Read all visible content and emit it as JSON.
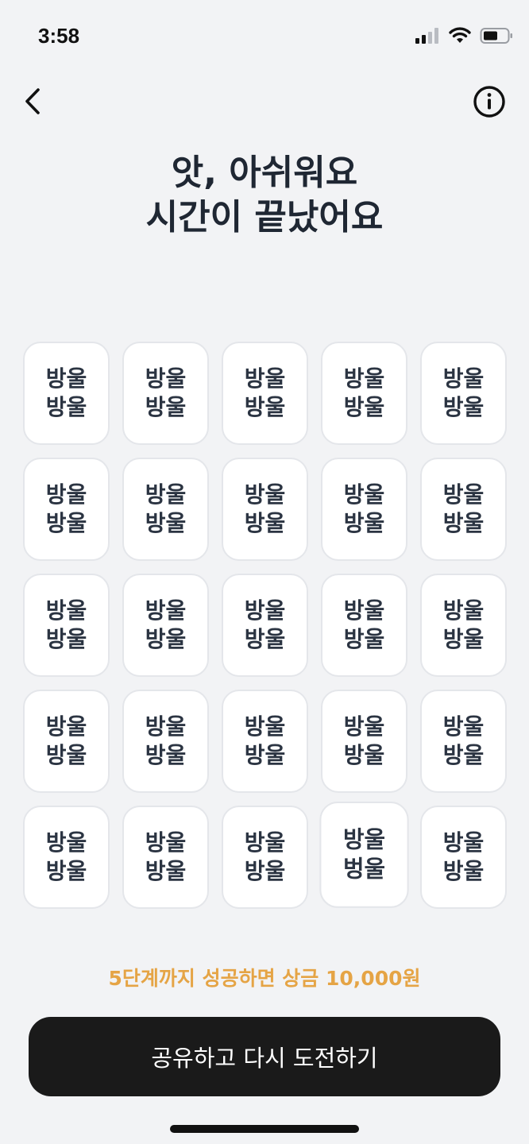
{
  "status_bar": {
    "time": "3:58",
    "icons": [
      "cellular-signal-icon",
      "wifi-icon",
      "battery-icon"
    ]
  },
  "nav": {
    "back_icon": "chevron-left-icon",
    "info_icon": "info-circle-icon"
  },
  "title": {
    "line1": "앗, 아쉬워요",
    "line2": "시간이 끝났어요"
  },
  "grid": {
    "tiles": [
      {
        "top": "방울",
        "bottom": "방울"
      },
      {
        "top": "방울",
        "bottom": "방울"
      },
      {
        "top": "방울",
        "bottom": "방울"
      },
      {
        "top": "방울",
        "bottom": "방울"
      },
      {
        "top": "방울",
        "bottom": "방울"
      },
      {
        "top": "방울",
        "bottom": "방울"
      },
      {
        "top": "방울",
        "bottom": "방울"
      },
      {
        "top": "방울",
        "bottom": "방울"
      },
      {
        "top": "방울",
        "bottom": "방울"
      },
      {
        "top": "방울",
        "bottom": "방울"
      },
      {
        "top": "방울",
        "bottom": "방울"
      },
      {
        "top": "방울",
        "bottom": "방울"
      },
      {
        "top": "방울",
        "bottom": "방울"
      },
      {
        "top": "방울",
        "bottom": "방울"
      },
      {
        "top": "방울",
        "bottom": "방울"
      },
      {
        "top": "방울",
        "bottom": "방울"
      },
      {
        "top": "방울",
        "bottom": "방울"
      },
      {
        "top": "방울",
        "bottom": "방울"
      },
      {
        "top": "방울",
        "bottom": "방울"
      },
      {
        "top": "방울",
        "bottom": "방울"
      },
      {
        "top": "방울",
        "bottom": "방울"
      },
      {
        "top": "방울",
        "bottom": "방울"
      },
      {
        "top": "방울",
        "bottom": "방울"
      },
      {
        "top": "방울",
        "bottom": "벙울",
        "odd_one": true
      },
      {
        "top": "방울",
        "bottom": "방울"
      }
    ]
  },
  "prize_text": "5단계까지 성공하면 상금 10,000원",
  "cta_label": "공유하고 다시 도전하기",
  "colors": {
    "background": "#f2f3f5",
    "prize": "#e5a445",
    "cta": "#1a1a1a"
  }
}
